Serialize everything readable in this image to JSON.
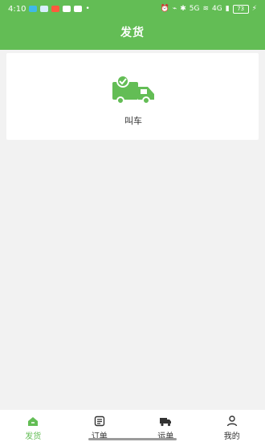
{
  "status_bar": {
    "time": "4:10",
    "network_label": "5G",
    "network_label_2": "4G",
    "battery": "73"
  },
  "header": {
    "title": "发货"
  },
  "main": {
    "card": {
      "action_label": "叫车",
      "icon": "truck-check-icon"
    }
  },
  "bottom_nav": {
    "items": [
      {
        "label": "发货",
        "icon": "home-icon",
        "active": true
      },
      {
        "label": "订单",
        "icon": "list-icon",
        "active": false
      },
      {
        "label": "运单",
        "icon": "truck-icon",
        "active": false
      },
      {
        "label": "我的",
        "icon": "user-icon",
        "active": false
      }
    ]
  },
  "colors": {
    "brand": "#63bd55",
    "nav_active": "#63bd55",
    "background": "#f2f2f2"
  }
}
